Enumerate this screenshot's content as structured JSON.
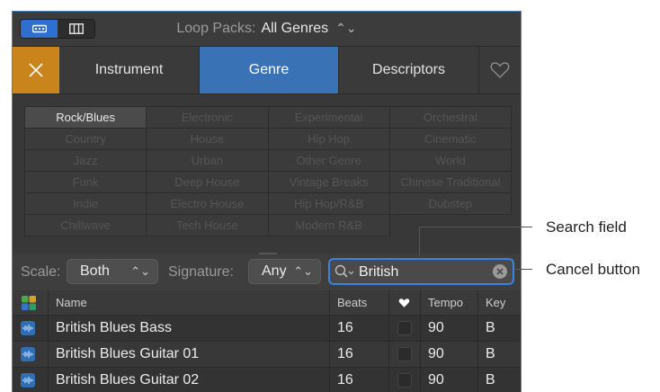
{
  "browser": {
    "loop_packs_label": "Loop Packs:",
    "loop_packs_value": "All Genres"
  },
  "tabs": [
    {
      "label": "Instrument",
      "active": false
    },
    {
      "label": "Genre",
      "active": true
    },
    {
      "label": "Descriptors",
      "active": false
    }
  ],
  "keywords": [
    {
      "label": "Rock/Blues",
      "selected": true
    },
    {
      "label": "Electronic",
      "selected": false
    },
    {
      "label": "Experimental",
      "selected": false
    },
    {
      "label": "Orchestral",
      "selected": false
    },
    {
      "label": "Country",
      "selected": false
    },
    {
      "label": "House",
      "selected": false
    },
    {
      "label": "Hip Hop",
      "selected": false
    },
    {
      "label": "Cinematic",
      "selected": false
    },
    {
      "label": "Jazz",
      "selected": false
    },
    {
      "label": "Urban",
      "selected": false
    },
    {
      "label": "Other Genre",
      "selected": false
    },
    {
      "label": "World",
      "selected": false
    },
    {
      "label": "Funk",
      "selected": false
    },
    {
      "label": "Deep House",
      "selected": false
    },
    {
      "label": "Vintage Breaks",
      "selected": false
    },
    {
      "label": "Chinese Traditional",
      "selected": false
    },
    {
      "label": "Indie",
      "selected": false
    },
    {
      "label": "Electro House",
      "selected": false
    },
    {
      "label": "Hip Hop/R&B",
      "selected": false
    },
    {
      "label": "Dubstep",
      "selected": false
    },
    {
      "label": "Chillwave",
      "selected": false
    },
    {
      "label": "Tech House",
      "selected": false
    },
    {
      "label": "Modern R&B",
      "selected": false
    }
  ],
  "filters": {
    "scale_label": "Scale:",
    "scale_value": "Both",
    "signature_label": "Signature:",
    "signature_value": "Any",
    "search_value": "British"
  },
  "table": {
    "columns": [
      "Name",
      "Beats",
      "Tempo",
      "Key"
    ],
    "rows": [
      {
        "name": "British Blues Bass",
        "beats": "16",
        "tempo": "90",
        "key": "B"
      },
      {
        "name": "British Blues Guitar 01",
        "beats": "16",
        "tempo": "90",
        "key": "B"
      },
      {
        "name": "British Blues Guitar 02",
        "beats": "16",
        "tempo": "90",
        "key": "B"
      }
    ]
  },
  "callouts": {
    "search_field": "Search field",
    "cancel_button": "Cancel button"
  },
  "colors": {
    "accent_blue": "#3a73b5",
    "reset_orange": "#c9841b",
    "search_ring": "#3a82e6"
  }
}
